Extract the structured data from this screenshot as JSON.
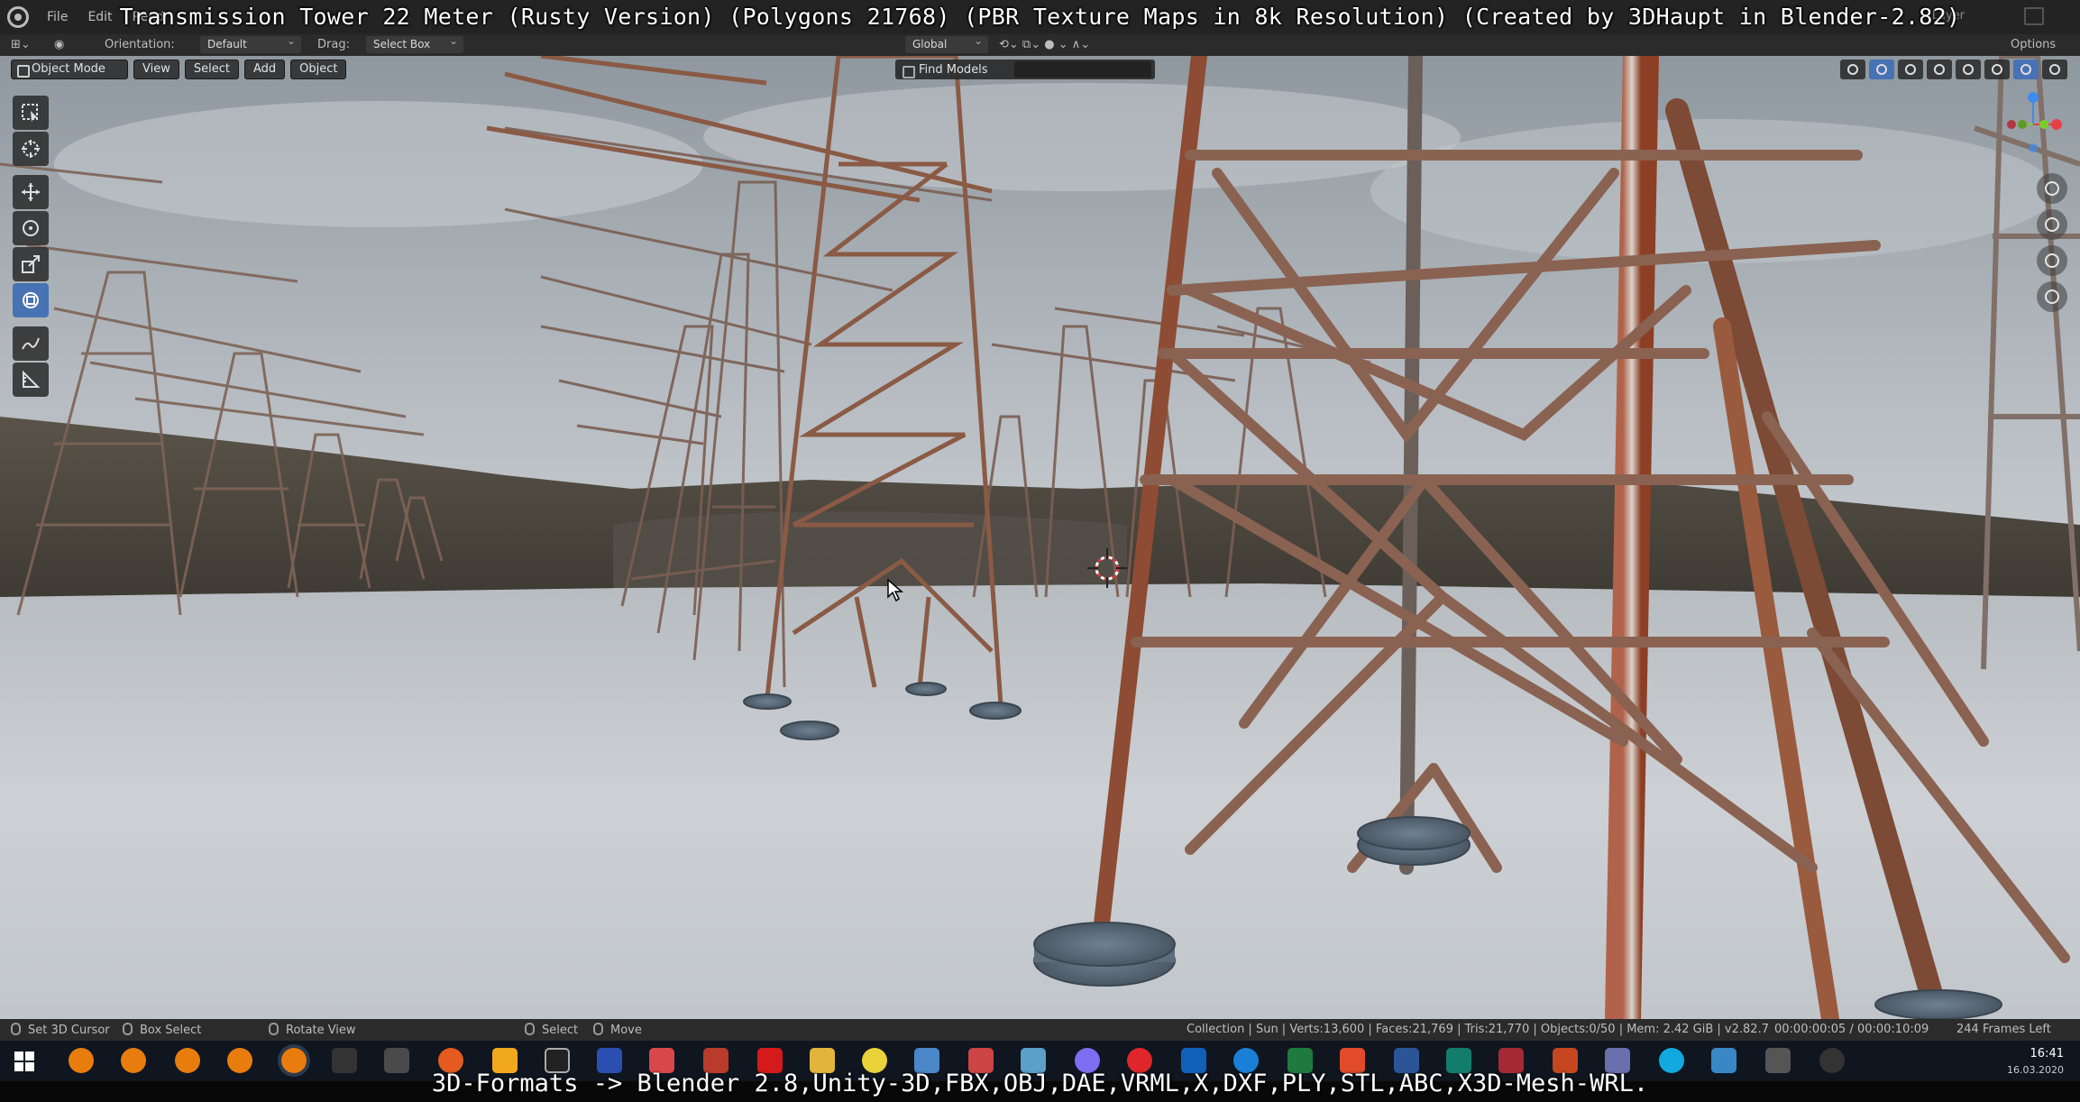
{
  "video": {
    "title": "Transmission Tower 22 Meter (Rusty Version) (Polygons 21768) (PBR Texture Maps in 8k Resolution) (Created by 3DHaupt in Blender-2.82)",
    "caption": "3D-Formats -> Blender 2.8,Unity-3D,FBX,OBJ,DAE,VRML,X,DXF,PLY,STL,ABC,X3D-Mesh-WRL."
  },
  "menubar": {
    "items": [
      "File",
      "Edit",
      "Rend"
    ],
    "right_label": "Layer"
  },
  "toolsettings": {
    "orientation_label": "Orientation:",
    "orientation_value": "Default",
    "drag_label": "Drag:",
    "drag_value": "Select Box",
    "transform_orientation": "Global",
    "options_label": "Options"
  },
  "viewport_header": {
    "mode": "Object Mode",
    "menus": [
      "View",
      "Select",
      "Add",
      "Object"
    ],
    "find_models": "Find Models"
  },
  "toolbar": {
    "tools": [
      "select-box-icon",
      "cursor-icon",
      "move-icon",
      "rotate-icon",
      "scale-icon",
      "transform-icon",
      "annotate-icon",
      "measure-icon"
    ],
    "active_tool": "transform-icon"
  },
  "gizmo": {
    "axes": [
      "X",
      "Y",
      "Z"
    ],
    "colors": {
      "x": "#e8404a",
      "y": "#7ccb2c",
      "z": "#3f8bef"
    }
  },
  "statusbar": {
    "left": [
      "Set 3D Cursor",
      "Box Select",
      "Rotate View"
    ],
    "middle": [
      "Select",
      "Move"
    ],
    "stats": "Collection | Sun | Verts:13,600 | Faces:21,769 | Tris:21,770 | Objects:0/50 | Mem: 2.42 GiB | v2.82.7",
    "timecode": "00:00:00:05 / 00:00:10:09",
    "frames_left": "244 Frames Left"
  },
  "taskbar": {
    "time": "16:41",
    "date": "16.03.2020"
  },
  "colors": {
    "ui_bg": "#232323",
    "accent": "#4772b3",
    "rust": "#9a4a2a",
    "steel": "#8e9aa3",
    "ground": "#c9ced3"
  }
}
